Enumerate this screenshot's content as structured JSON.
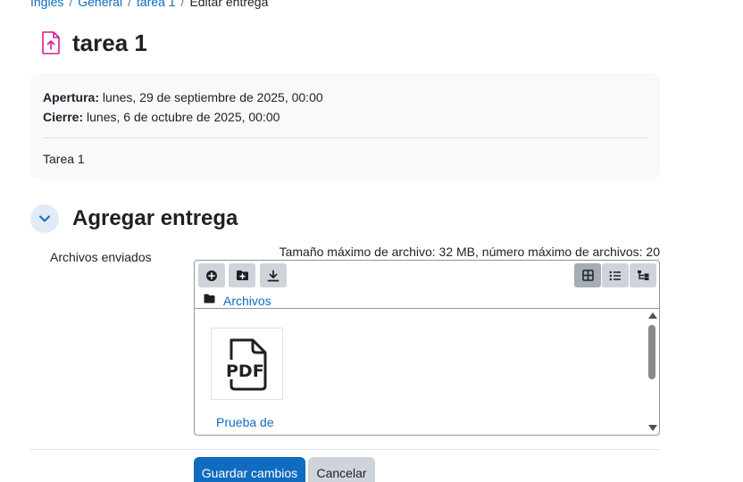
{
  "breadcrumb": {
    "items": [
      "Inglés",
      "General",
      "tarea 1"
    ],
    "current": "Editar entrega",
    "separator": "/"
  },
  "page": {
    "title": "tarea 1",
    "icon": "assignment-upload-icon"
  },
  "dates": {
    "open_label": "Apertura:",
    "open_value": " lunes, 29 de septiembre de 2025, 00:00",
    "close_label": "Cierre:",
    "close_value": " lunes, 6 de octubre de 2025, 00:00",
    "description": "Tarea 1"
  },
  "section": {
    "title": "Agregar entrega",
    "toggle_icon": "chevron-down-icon"
  },
  "form": {
    "files_label": "Archivos enviados",
    "limits": "Tamaño máximo de archivo: 32 MB, número máximo de archivos: 20"
  },
  "filepicker": {
    "toolbar_icons": [
      "add-file-icon",
      "create-folder-icon",
      "download-icon"
    ],
    "view_icons": [
      "grid-view-icon",
      "list-view-icon",
      "tree-view-icon"
    ],
    "active_view": "grid",
    "path_label": "Archivos",
    "files": [
      {
        "name": "Prueba de",
        "type_label": "PDF",
        "icon": "pdf-file-icon"
      }
    ]
  },
  "actions": {
    "save": "Guardar cambios",
    "cancel": "Cancelar"
  },
  "colors": {
    "link": "#0f6cbf",
    "primary": "#0f6cbf",
    "secondary": "#ced4da",
    "assign_icon": "#d81b8c"
  }
}
